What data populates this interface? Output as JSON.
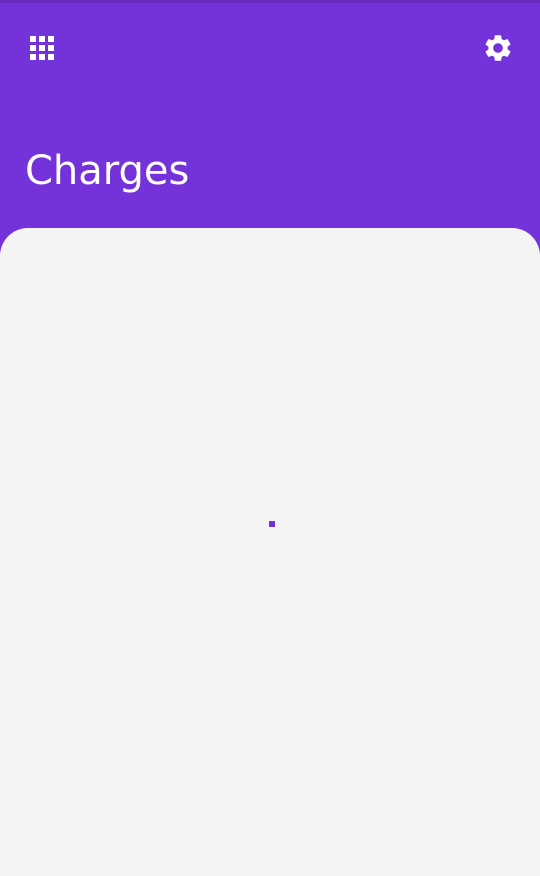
{
  "app": {
    "accent_color": "#7432DB",
    "background_color": "#F4F4F4"
  },
  "header": {
    "title": "Charges",
    "left_icon": "apps-grid-icon",
    "right_icon": "gear-icon"
  },
  "content": {
    "state": "loading",
    "spinner_icon": "loading-spinner-icon"
  }
}
